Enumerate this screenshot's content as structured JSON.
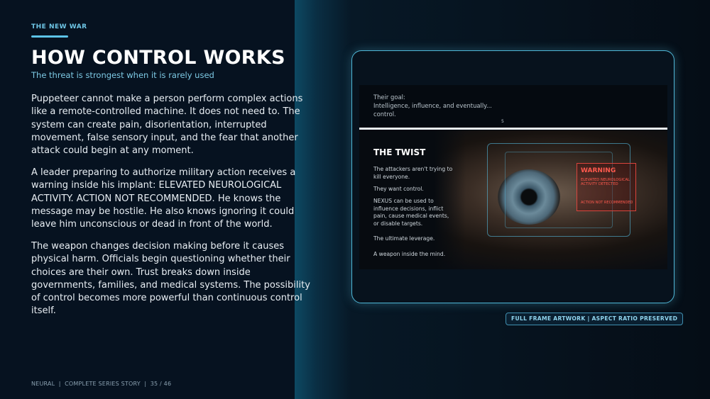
{
  "slide": {
    "eyebrow": "THE NEW WAR",
    "title": "HOW CONTROL WORKS",
    "subtitle": "The threat is strongest when it is rarely used",
    "paragraphs": [
      "Puppeteer cannot make a person perform complex actions like a remote-controlled machine. It does not need to. The system can create pain, disorientation, interrupted movement, false sensory input, and the fear that another attack could begin at any moment.",
      "A leader preparing to authorize military action receives a warning inside his implant: ELEVATED NEUROLOGICAL ACTIVITY. ACTION NOT RECOMMENDED. He knows the message may be hostile. He also knows ignoring it could leave him unconscious or dead in front of the world.",
      "The weapon changes decision making before it causes physical harm. Officials begin questioning whether their choices are their own. Trust breaks down inside governments, families, and medical systems. The possibility of control becomes more powerful than continuous control itself."
    ],
    "footer": "NEURAL  |  COMPLETE SERIES STORY  |  35 / 46"
  },
  "artwork": {
    "top_lines": [
      "Their goal:",
      "Intelligence, influence, and eventually...",
      "control."
    ],
    "top_marker": "5",
    "twist_title": "THE TWIST",
    "twist_lines": [
      "The attackers aren't trying to kill everyone.",
      "They want control.",
      "NEXUS can be used to influence decisions, inflict pain, cause medical events, or disable targets.",
      "The ultimate leverage.",
      "A weapon inside the mind."
    ],
    "warning": {
      "title": "WARNING",
      "sub": "ELEVATED NEUROLOGICAL ACTIVITY DETECTED",
      "action": "ACTION NOT RECOMMENDED"
    },
    "badge": "FULL FRAME ARTWORK  |  ASPECT RATIO PRESERVED"
  },
  "colors": {
    "accent": "#5cc3e8",
    "background": "#061220",
    "warning": "#ff5a4e"
  }
}
